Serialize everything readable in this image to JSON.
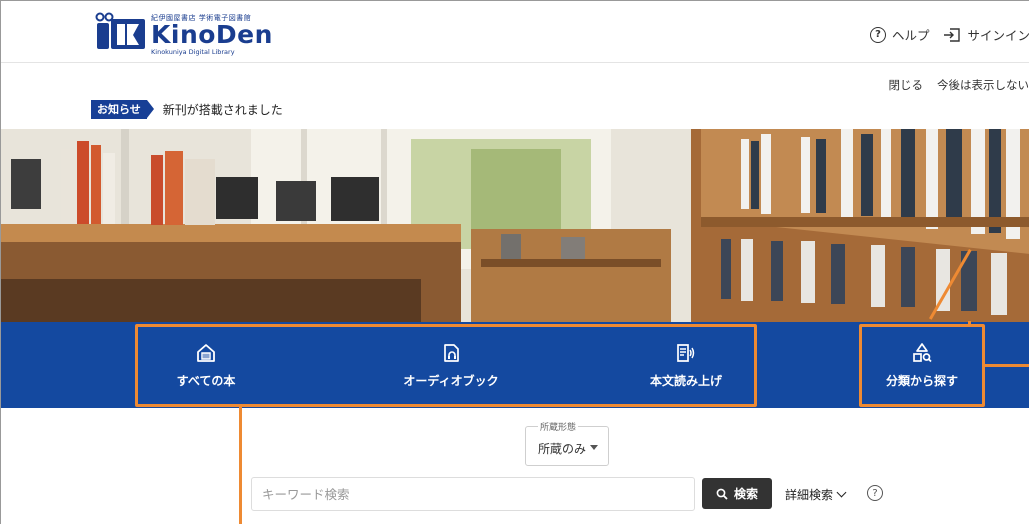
{
  "header": {
    "logo_publisher": "紀伊國屋書店 学術電子図書館",
    "logo_name": "KinoDen",
    "logo_subtitle": "Kinokuniya Digital Library",
    "help_label": "ヘルプ",
    "signin_label": "サインイン"
  },
  "notice": {
    "close_label": "閉じる",
    "hide_label": "今後は表示しない",
    "badge": "お知らせ",
    "message": "新刊が搭載されました"
  },
  "nav": {
    "all_books": "すべての本",
    "audiobook": "オーディオブック",
    "text_to_speech": "本文読み上げ",
    "browse_by_category": "分類から探す"
  },
  "search": {
    "holding_label": "所蔵形態",
    "holding_value": "所蔵のみ",
    "placeholder": "キーワード検索",
    "search_button": "検索",
    "advanced_label": "詳細検索",
    "help_glyph": "?"
  },
  "colors": {
    "brand_blue": "#1449a0",
    "highlight_orange": "#ee8a33"
  }
}
